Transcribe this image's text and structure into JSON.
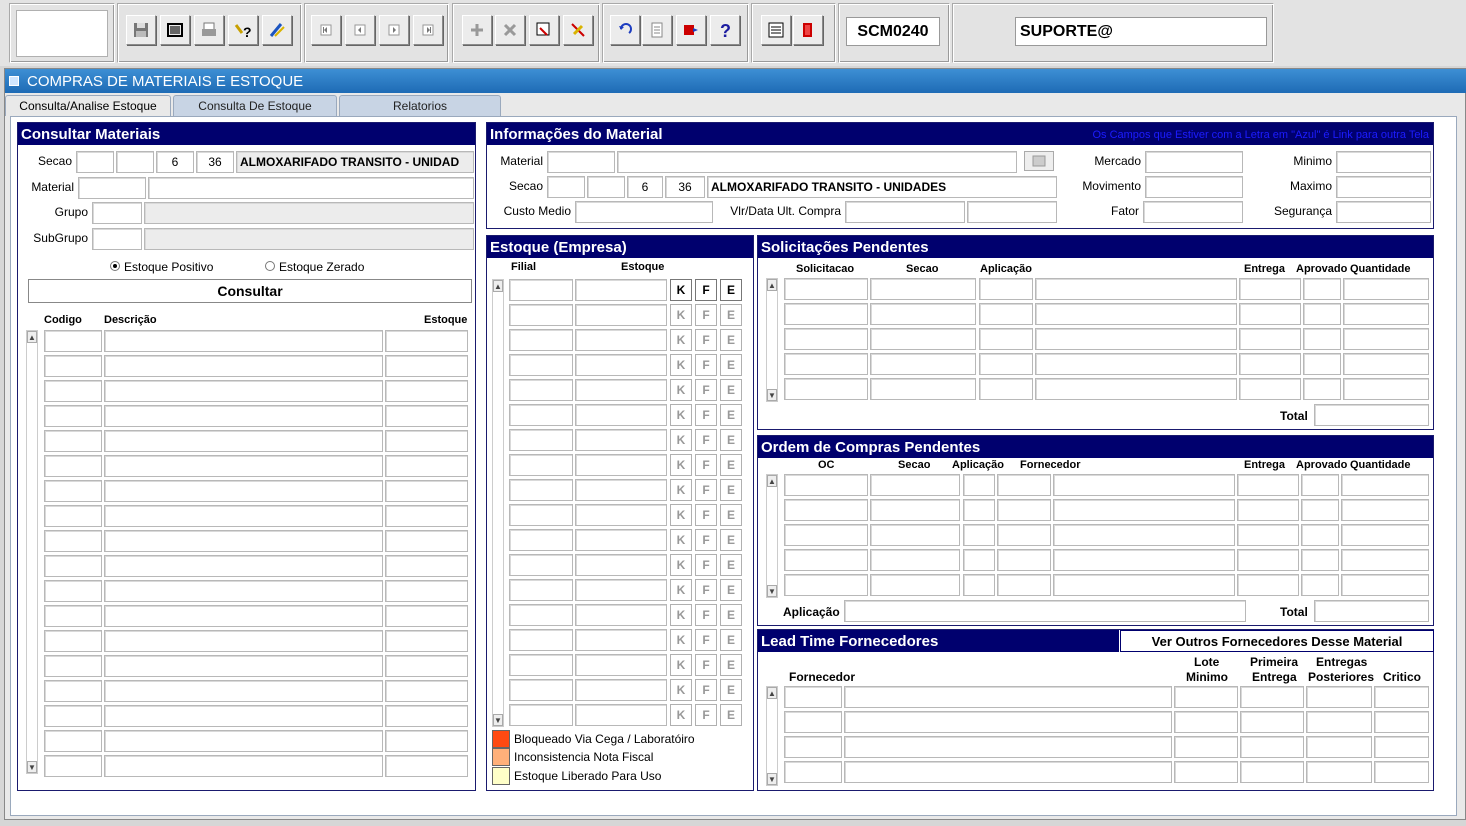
{
  "toolbar": {
    "form_code": "SCM0240",
    "user": "SUPORTE@",
    "icons": [
      "save-icon",
      "window-icon",
      "print-icon",
      "help-query-icon",
      "edit-pen-icon",
      "first-record-icon",
      "previous-record-icon",
      "next-record-icon",
      "last-record-icon",
      "insert-record-icon",
      "delete-record-icon",
      "query-icon",
      "clear-icon",
      "undo-icon",
      "clipboard-icon",
      "list-icon",
      "help-icon",
      "menu-icon",
      "exit-icon"
    ]
  },
  "window": {
    "title": "COMPRAS DE MATERIAIS E ESTOQUE",
    "tabs": [
      "Consulta/Analise Estoque",
      "Consulta De Estoque",
      "Relatorios"
    ]
  },
  "consultar": {
    "title": "Consultar Materiais",
    "secao_label": "Secao",
    "secao_values": [
      "",
      "",
      "6",
      "36"
    ],
    "secao_desc": "ALMOXARIFADO TRANSITO - UNIDAD",
    "material_label": "Material",
    "grupo_label": "Grupo",
    "subgrupo_label": "SubGrupo",
    "radio_positivo": "Estoque Positivo",
    "radio_zerado": "Estoque Zerado",
    "btn_consultar": "Consultar",
    "col_codigo": "Codigo",
    "col_descricao": "Descrição",
    "col_estoque": "Estoque"
  },
  "info": {
    "title": "Informações do Material",
    "note": "Os Campos que Estiver com a Letra em \"Azul\" é Link para outra Tela",
    "material_label": "Material",
    "secao_label": "Secao",
    "secao_values": [
      "",
      "",
      "6",
      "36"
    ],
    "secao_desc": "ALMOXARIFADO TRANSITO - UNIDADES",
    "custo_label": "Custo Medio",
    "vlr_label": "Vlr/Data Ult. Compra",
    "mercado_label": "Mercado",
    "movimento_label": "Movimento",
    "fator_label": "Fator",
    "minimo_label": "Minimo",
    "maximo_label": "Maximo",
    "seguranca_label": "Segurança"
  },
  "estoque": {
    "title": "Estoque  (Empresa)",
    "col_filial": "Filial",
    "col_estoque": "Estoque",
    "k": "K",
    "f": "F",
    "e": "E",
    "legend": [
      {
        "label": "Bloqueado Via Cega / Laboratóiro",
        "color": "#ff4a12"
      },
      {
        "label": "Inconsistencia Nota Fiscal",
        "color": "#ffb07a"
      },
      {
        "label": "Estoque Liberado Para Uso",
        "color": "#ffffc8"
      }
    ]
  },
  "solic": {
    "title": "Solicitações Pendentes",
    "cols": [
      "Solicitacao",
      "Secao",
      "Aplicação",
      "Entrega",
      "Aprovado",
      "Quantidade"
    ],
    "total_label": "Total"
  },
  "ordem": {
    "title": "Ordem de Compras Pendentes",
    "cols": [
      "OC",
      "Secao",
      "Aplicação",
      "Fornecedor",
      "Entrega",
      "Aprovado",
      "Quantidade"
    ],
    "aplicacao_label": "Aplicação",
    "total_label": "Total"
  },
  "lead": {
    "title": "Lead Time Fornecedores",
    "btn": "Ver Outros Fornecedores Desse Material",
    "col_fornecedor": "Fornecedor",
    "col_lote1": "Lote",
    "col_lote2": "Minimo",
    "col_prim1": "Primeira",
    "col_prim2": "Entrega",
    "col_entr1": "Entregas",
    "col_entr2": "Posteriores",
    "col_critico": "Critico"
  }
}
